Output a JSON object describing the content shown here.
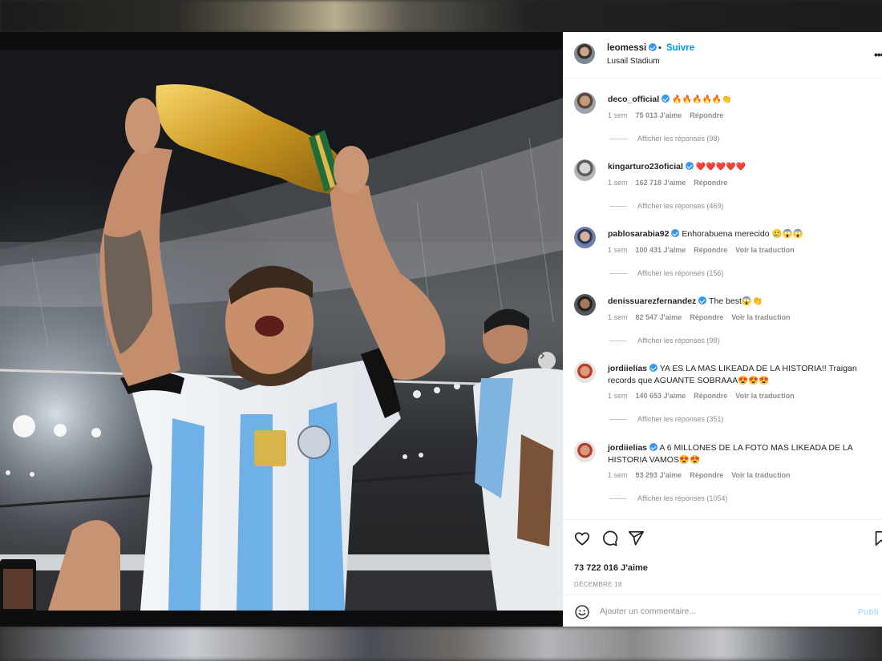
{
  "post": {
    "username": "leomessi",
    "dot": "•",
    "follow_label": "Suivre",
    "location": "Lusail Stadium",
    "more_icon": "more-horizontal-icon"
  },
  "comments": [
    {
      "user": "deco_official",
      "text": "🔥🔥🔥🔥🔥👏",
      "time": "1 sem",
      "likes": "75 013 J'aime",
      "reply": "Répondre",
      "translate": "",
      "replies": "Afficher les réponses (98)"
    },
    {
      "user": "kingarturo23oficial",
      "text": "❤️❤️❤️❤️❤️",
      "time": "1 sem",
      "likes": "162 718 J'aime",
      "reply": "Répondre",
      "translate": "",
      "replies": "Afficher les réponses (469)"
    },
    {
      "user": "pablosarabia92",
      "text": "Enhorabuena merecido 🥲😱😱",
      "time": "1 sem",
      "likes": "100 431 J'aime",
      "reply": "Répondre",
      "translate": "Voir la traduction",
      "replies": "Afficher les réponses (156)"
    },
    {
      "user": "denissuarezfernandez",
      "text": "The best😱👏",
      "time": "1 sem",
      "likes": "82 547 J'aime",
      "reply": "Répondre",
      "translate": "Voir la traduction",
      "replies": "Afficher les réponses (98)"
    },
    {
      "user": "jordiielias",
      "text": "YA ES LA MAS LIKEADA DE LA HISTORIA!! Traigan records que AGUANTE SOBRAAA😍😍😍",
      "time": "1 sem",
      "likes": "140 653 J'aime",
      "reply": "Répondre",
      "translate": "Voir la traduction",
      "replies": "Afficher les réponses (351)"
    },
    {
      "user": "jordiielias",
      "text": "A 6 MILLONES DE LA FOTO MAS LIKEADA DE LA HISTORIA VAMOS😍😍",
      "time": "1 sem",
      "likes": "93 293 J'aime",
      "reply": "Répondre",
      "translate": "Voir la traduction",
      "replies": "Afficher les réponses (1054)"
    }
  ],
  "footer": {
    "likes": "73 722 016 J'aime",
    "date": "DÉCEMBRE 18",
    "comment_placeholder": "Ajouter un commentaire...",
    "publish_label": "Publi"
  },
  "colors": {
    "link_blue": "#0095f6",
    "verified_blue": "#3797f0",
    "muted_text": "#8e8e8e"
  }
}
